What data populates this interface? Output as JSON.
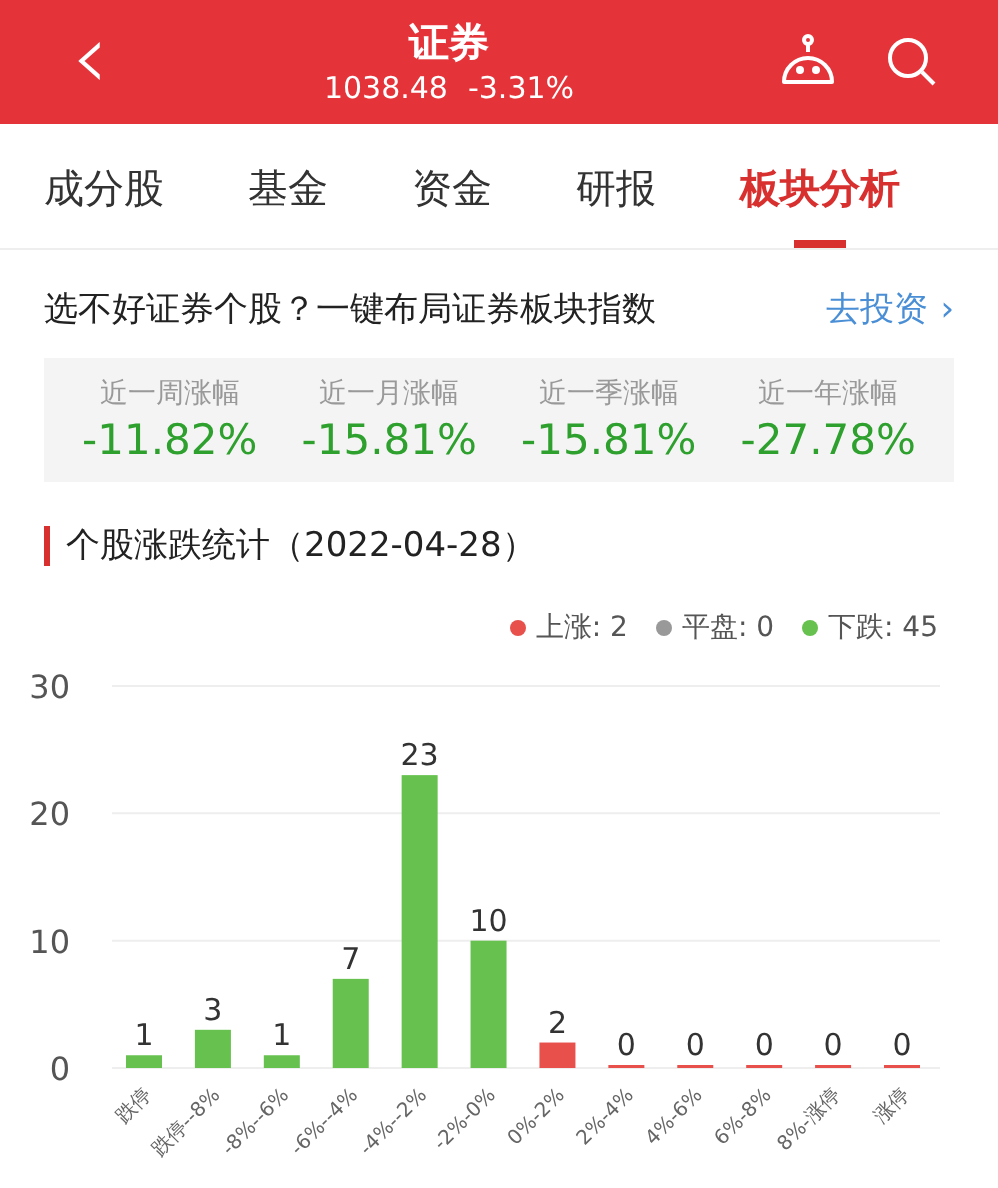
{
  "header": {
    "back": "‹",
    "title": "证券",
    "price": "1038.48",
    "change": "-3.31%"
  },
  "tabs": [
    {
      "label": "成分股",
      "selected": false
    },
    {
      "label": "基金",
      "selected": false
    },
    {
      "label": "资金",
      "selected": false
    },
    {
      "label": "研报",
      "selected": false
    },
    {
      "label": "板块分析",
      "selected": true
    }
  ],
  "promo": {
    "text": "选不好证券个股？一键布局证券板块指数",
    "link": "去投资",
    "chevron": "›"
  },
  "stats": [
    {
      "label": "近一周涨幅",
      "value": "-11.82%"
    },
    {
      "label": "近一月涨幅",
      "value": "-15.81%"
    },
    {
      "label": "近一季涨幅",
      "value": "-15.81%"
    },
    {
      "label": "近一年涨幅",
      "value": "-27.78%"
    }
  ],
  "section_title": "个股涨跌统计（2022-04-28）",
  "legend": [
    {
      "label": "上涨: 2",
      "color": "#e8504b"
    },
    {
      "label": "平盘: 0",
      "color": "#999999"
    },
    {
      "label": "下跌: 45",
      "color": "#66c14e"
    }
  ],
  "chart_data": {
    "type": "bar",
    "categories": [
      "跌停",
      "跌停--8%",
      "-8%--6%",
      "-6%--4%",
      "-4%--2%",
      "-2%-0%",
      "0%-2%",
      "2%-4%",
      "4%-6%",
      "6%-8%",
      "8%-涨停",
      "涨停"
    ],
    "series": [
      {
        "color": "#66c14e",
        "values": [
          1,
          3,
          1,
          7,
          23,
          10,
          null,
          null,
          null,
          null,
          null,
          null
        ]
      },
      {
        "color": "#e8504b",
        "values": [
          null,
          null,
          null,
          null,
          null,
          null,
          2,
          0,
          0,
          0,
          0,
          0
        ]
      }
    ],
    "ylim": [
      0,
      30
    ],
    "yticks": [
      0,
      10,
      20,
      30
    ],
    "data_labels": true
  }
}
